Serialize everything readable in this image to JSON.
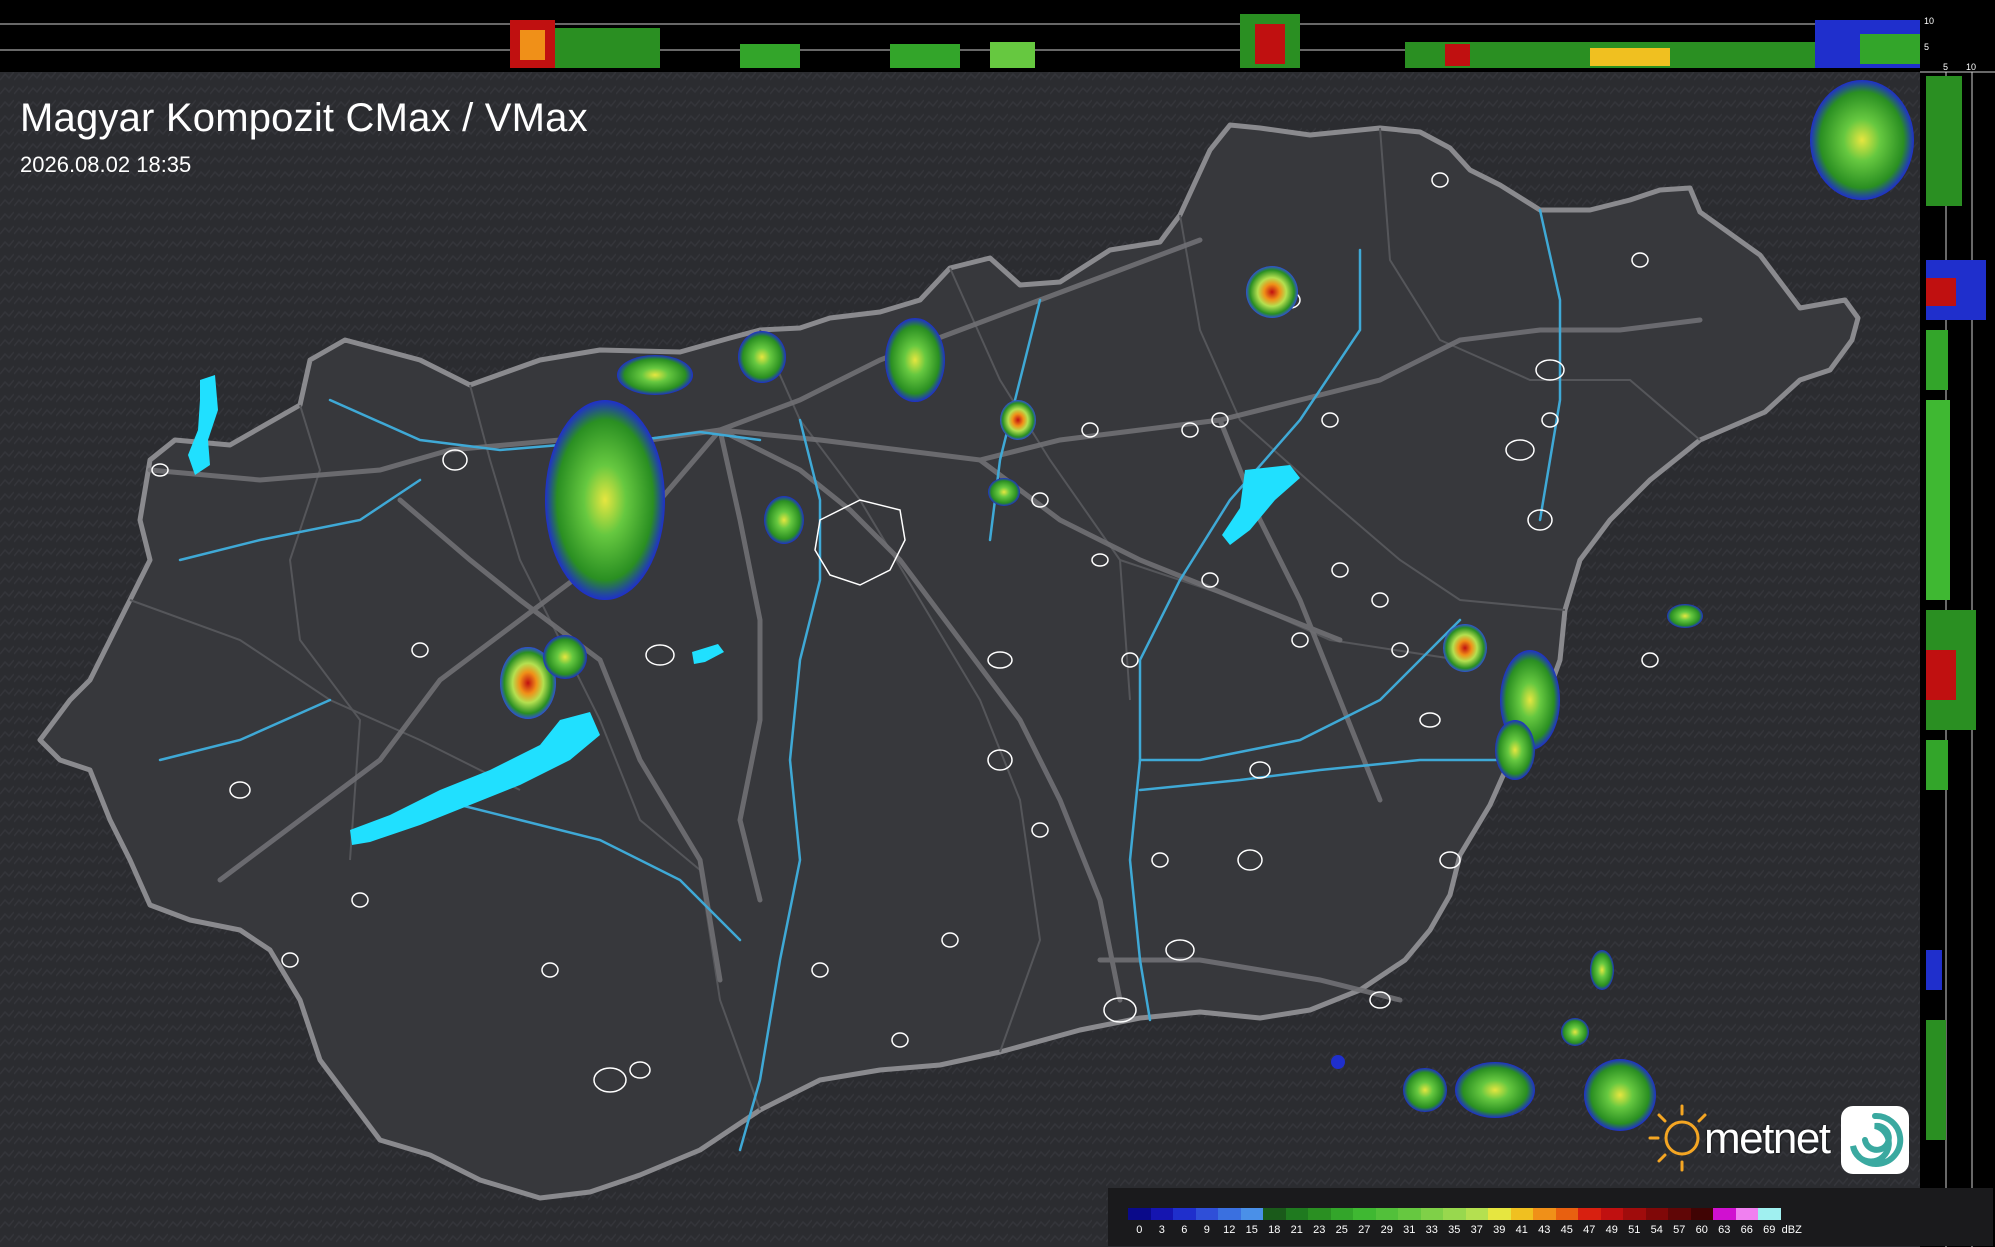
{
  "title": "Magyar Kompozit CMax / VMax",
  "timestamp": "2026.08.02 18:35",
  "brand": {
    "name": "metnet",
    "sun_color": "#f5a623",
    "badge_color": "#ffffff",
    "badge_swirl_color": "#3aa9a0"
  },
  "side_profile": {
    "top_axis_labels": [
      "10",
      "5"
    ],
    "right_axis_labels": [
      "5",
      "10"
    ]
  },
  "legend": {
    "unit": "dBZ",
    "values": [
      "0",
      "3",
      "6",
      "9",
      "12",
      "15",
      "18",
      "21",
      "23",
      "25",
      "27",
      "29",
      "31",
      "33",
      "35",
      "37",
      "39",
      "41",
      "43",
      "45",
      "47",
      "49",
      "51",
      "54",
      "57",
      "60",
      "63",
      "66",
      "69"
    ],
    "colors": [
      "#0a0a8a",
      "#1515b0",
      "#1f2fcc",
      "#2f4fd8",
      "#3a70e0",
      "#4a90e8",
      "#1a5a1a",
      "#1f7a1f",
      "#2a8f22",
      "#33a52a",
      "#3fb832",
      "#52c03a",
      "#66c840",
      "#7fd048",
      "#98d84e",
      "#b4e050",
      "#e6e640",
      "#f0c020",
      "#f09018",
      "#e86010",
      "#d82010",
      "#c01010",
      "#a00c0c",
      "#800808",
      "#600606",
      "#400404",
      "#d010d0",
      "#f080f0",
      "#a0f0f0"
    ]
  },
  "map_colors": {
    "background": "#2b2c30",
    "country": "#37383c",
    "border": "#8a8a8e",
    "roads": "#707074",
    "rivers": "#3fa9d6",
    "lakes": "#20e0ff",
    "cities": "#ffffff"
  },
  "radar_echoes": [
    {
      "id": "cell-nw-1",
      "center": "47.65N 17.95E",
      "max_dbz": 35
    },
    {
      "id": "cell-nw-2",
      "center": "47.85N 18.20E",
      "max_dbz": 37
    },
    {
      "id": "cell-balaton-n",
      "center": "47.10N 17.80E",
      "max_dbz": 51
    },
    {
      "id": "cell-n-1",
      "center": "48.05N 18.85E",
      "max_dbz": 37
    },
    {
      "id": "cell-n-2",
      "center": "48.05N 19.70E",
      "max_dbz": 37
    },
    {
      "id": "cell-n-3",
      "center": "47.90N 19.80E",
      "max_dbz": 47
    },
    {
      "id": "cell-miskolc",
      "center": "48.20N 20.65E",
      "max_dbz": 51
    },
    {
      "id": "cell-se-1",
      "center": "46.90N 21.95E",
      "max_dbz": 51
    },
    {
      "id": "cell-s-1",
      "center": "45.55N 21.90E",
      "max_dbz": 39
    }
  ]
}
